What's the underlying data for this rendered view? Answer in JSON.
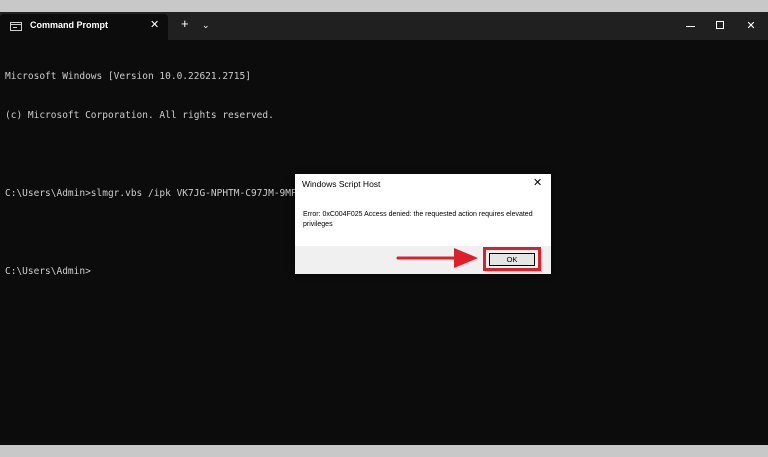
{
  "window": {
    "tab_title": "Command Prompt",
    "tab_close": "✕",
    "new_tab": "+",
    "dropdown": "⌄",
    "close": "✕"
  },
  "console": {
    "lines": [
      "Microsoft Windows [Version 10.0.22621.2715]",
      "(c) Microsoft Corporation. All rights reserved.",
      "",
      "C:\\Users\\Admin>slmgr.vbs /ipk VK7JG-NPHTM-C97JM-9MPGT-3V66T",
      "",
      "C:\\Users\\Admin>"
    ]
  },
  "dialog": {
    "title": "Windows Script Host",
    "close": "✕",
    "message": "Error: 0xC004F025 Access denied: the requested action requires elevated privileges",
    "ok_label": "OK"
  },
  "colors": {
    "console_bg": "#0c0c0c",
    "titlebar_bg": "#202020",
    "highlight": "#e01e2a"
  },
  "icons": [
    "console-app-icon",
    "close-icon",
    "plus-icon",
    "chevron-down-icon",
    "minimize-icon",
    "maximize-icon",
    "arrow-right-icon"
  ]
}
